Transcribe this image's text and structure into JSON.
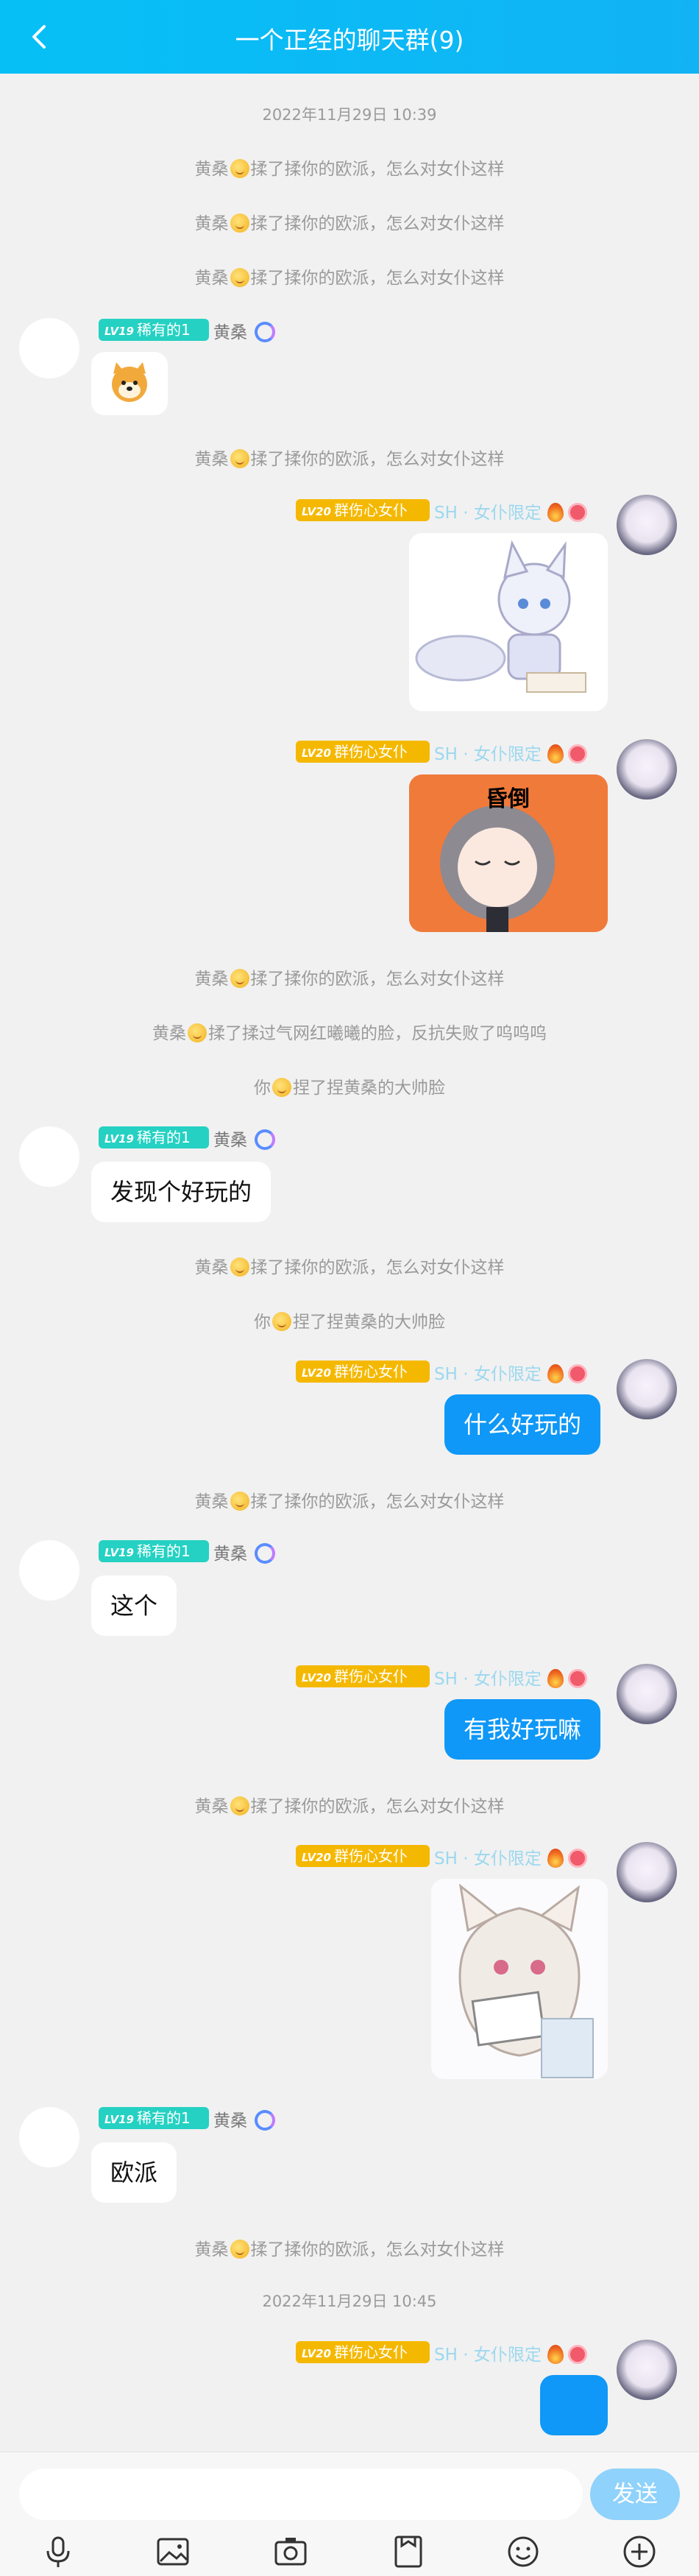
{
  "header": {
    "title": "一个正经的聊天群(9)"
  },
  "timestamps": {
    "t1": "2022年11月29日 10:39",
    "t2": "2022年11月29日 10:45"
  },
  "system": {
    "rub_prefix": "黄桑",
    "rub_suffix": "揉了揉你的欧派，怎么对女仆这样",
    "face_prefix": "黄桑",
    "face_suffix": "揉了揉过气网红曦曦的脸，反抗失败了呜呜呜",
    "pinch_prefix": "你",
    "pinch_suffix": "捏了捏黄桑的大帅脸"
  },
  "user_left": {
    "level": "LV19",
    "title": "稀有的1",
    "name": "黄桑"
  },
  "user_right": {
    "level": "LV20",
    "title": "群伤心女仆",
    "name": "SH · 女仆限定"
  },
  "messages": {
    "m1": "发现个好玩的",
    "m2": "什么好玩的",
    "m3": "这个",
    "m4": "有我好玩嘛",
    "m5": "欧派"
  },
  "sticker": {
    "text": "昏倒"
  },
  "bottom": {
    "send_label": "发送"
  },
  "icons": [
    "back-icon",
    "voice-icon",
    "image-icon",
    "camera-icon",
    "file-icon",
    "emoji-icon",
    "plus-icon",
    "fire-icon",
    "swirl-icon"
  ]
}
